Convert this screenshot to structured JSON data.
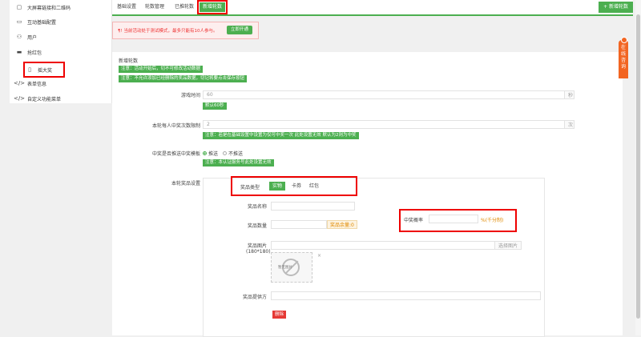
{
  "sidebar": {
    "items": [
      {
        "label": "大屏幕链接和二维码",
        "icon": "screen-icon"
      },
      {
        "label": "互动基础配置",
        "icon": "settings-icon"
      },
      {
        "label": "用户",
        "icon": "users-icon"
      },
      {
        "label": "抢红包",
        "icon": "redpacket-icon"
      },
      {
        "label": "摇大奖",
        "icon": "shake-icon"
      },
      {
        "label": "表单信息",
        "icon": "code-icon"
      },
      {
        "label": "自定义功能菜单",
        "icon": "code-icon"
      }
    ]
  },
  "tabs": [
    "基础设置",
    "轮数管理",
    "已推轮数",
    "新增轮数"
  ],
  "add_round_button": "+ 新增轮数",
  "notice": {
    "text": "¶! 当前活动处于测试模式，最多只能有10人参与。",
    "button": "立即开通"
  },
  "panel": {
    "title": "新增轮数",
    "notes": [
      "注意：活动开始后，切不可修改活动数据",
      "注意：不允许添加已经删除的奖品数据，切记将要点击保存按钮"
    ],
    "game_time": {
      "label": "游戏时间",
      "value": "60",
      "unit": "秒",
      "hint": "默认60秒"
    },
    "max_wins": {
      "label": "本轮每人中奖次数限制",
      "value": "2",
      "unit": "次",
      "hint": "注意：若是在基础设置中设置为仅可中奖一次 此处设置无效 默认为2则为中奖"
    },
    "push_template": {
      "label": "中奖是否推送中奖模板",
      "options": [
        "推送",
        "不推送"
      ],
      "selected": "推送",
      "hint": "注意：本认证服务号此处设置无效"
    },
    "prize_settings": {
      "label": "本轮奖品设置",
      "type_label": "奖品类型",
      "types": [
        "实物",
        "卡券",
        "红包"
      ],
      "selected_type": "实物",
      "name_label": "奖品名称",
      "qty_label": "奖品数量",
      "qty_suffix": "奖品余量:0",
      "rate_label": "中奖概率",
      "rate_suffix": "%(千分制)",
      "image_label": "奖品图片",
      "image_size": "(180*180)",
      "image_button": "选择图片",
      "no_image_text": "暂无图片",
      "provider_label": "奖品提供方",
      "delete_button": "删除"
    }
  },
  "float_chat": "在线咨询"
}
